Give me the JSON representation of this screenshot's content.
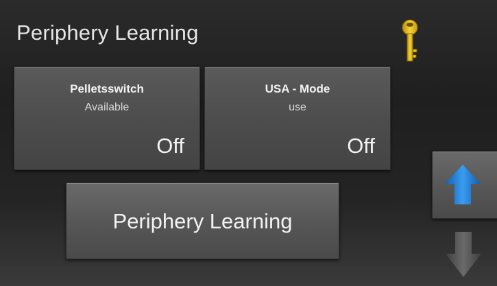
{
  "header": {
    "title": "Periphery Learning",
    "key_icon": "key-icon"
  },
  "tiles": [
    {
      "name": "Pelletsswitch",
      "subtitle": "Available",
      "state": "Off"
    },
    {
      "name": "USA - Mode",
      "subtitle": "use",
      "state": "Off"
    }
  ],
  "main_button": {
    "label": "Periphery Learning"
  },
  "nav": {
    "up_icon": "arrow-up-icon",
    "down_icon": "arrow-down-icon",
    "up_color": "#1a78d2",
    "down_color": "#5c5c5c"
  },
  "colors": {
    "key": "#e8c31f",
    "background": "#232323"
  }
}
